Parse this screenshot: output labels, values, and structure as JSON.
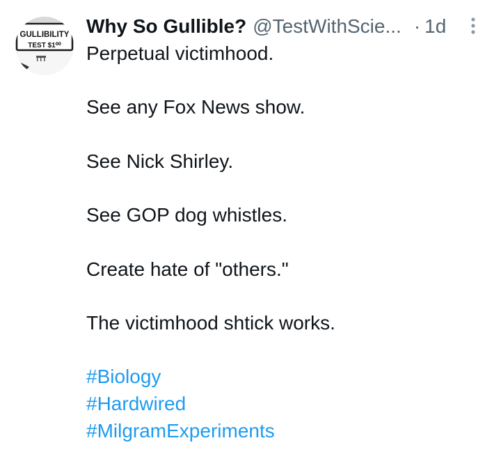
{
  "tweet": {
    "author": {
      "display_name": "Why So Gullible?",
      "handle": "@TestWithScie...",
      "avatar": {
        "sign_line1": "GULLIBILITY",
        "sign_line2": "TEST $1⁰⁰"
      }
    },
    "separator": "·",
    "timestamp": "1d",
    "more_icon": "more-vertical-icon",
    "body_lines": [
      "Perpetual victimhood.",
      "",
      "See any Fox News show.",
      "",
      "See Nick Shirley.",
      "",
      "See GOP dog whistles.",
      "",
      "Create hate of \"others.\"",
      "",
      "The victimhood shtick works.",
      ""
    ],
    "hashtags": [
      "#Biology",
      "#Hardwired",
      "#MilgramExperiments"
    ],
    "colors": {
      "text": "#0f1419",
      "secondary": "#536471",
      "link": "#1d9bf0"
    }
  }
}
